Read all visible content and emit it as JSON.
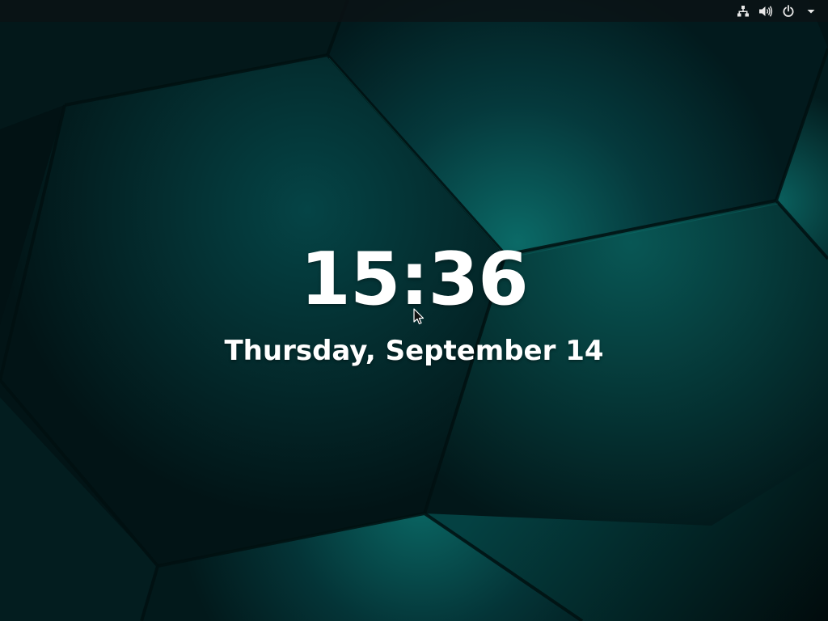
{
  "lock_screen": {
    "time": "15:36",
    "date": "Thursday, September 14"
  },
  "topbar": {
    "icons": [
      "network-icon",
      "volume-icon",
      "power-icon",
      "menu-arrow-icon"
    ]
  },
  "colors": {
    "wallpaper_dark": "#021315",
    "wallpaper_teal": "#0a6e6a",
    "topbar_bg": "#0c1214",
    "text": "#ffffff"
  }
}
